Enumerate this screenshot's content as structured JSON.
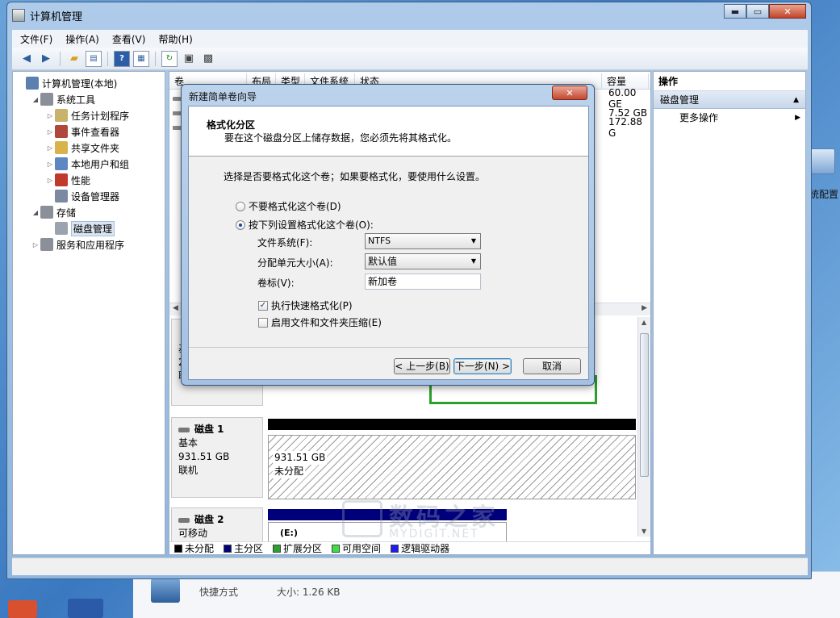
{
  "window": {
    "title": "计算机管理",
    "caption": {
      "minimize": "▬",
      "maximize": "▭",
      "close": "✕"
    }
  },
  "menu": [
    "文件(F)",
    "操作(A)",
    "查看(V)",
    "帮助(H)"
  ],
  "toolbar": {
    "icons": [
      "back-arrow-icon",
      "forward-arrow-icon",
      "up-folder-icon",
      "show-tree-icon",
      "help-icon",
      "properties-icon",
      "refresh-icon",
      "export-icon",
      "settings-icon"
    ],
    "help_glyph": "?"
  },
  "tree": {
    "items": [
      {
        "label": "计算机管理(本地)",
        "expander": "",
        "icon_color": "#5b7fae",
        "indent": 0
      },
      {
        "label": "系统工具",
        "expander": "◢",
        "icon_color": "#8a8f99",
        "indent": 1
      },
      {
        "label": "任务计划程序",
        "expander": "▷",
        "icon_color": "#c9b26b",
        "indent": 2
      },
      {
        "label": "事件查看器",
        "expander": "▷",
        "icon_color": "#b0473c",
        "indent": 2
      },
      {
        "label": "共享文件夹",
        "expander": "▷",
        "icon_color": "#d8b24a",
        "indent": 2
      },
      {
        "label": "本地用户和组",
        "expander": "▷",
        "icon_color": "#5d86c2",
        "indent": 2
      },
      {
        "label": "性能",
        "expander": "▷",
        "icon_color": "#c0392b",
        "indent": 2
      },
      {
        "label": "设备管理器",
        "expander": "",
        "icon_color": "#7b8aa0",
        "indent": 2
      },
      {
        "label": "存储",
        "expander": "◢",
        "icon_color": "#8a8f99",
        "indent": 1
      },
      {
        "label": "磁盘管理",
        "expander": "",
        "icon_color": "#9aa3af",
        "indent": 2,
        "selected": true
      },
      {
        "label": "服务和应用程序",
        "expander": "▷",
        "icon_color": "#8a8f99",
        "indent": 1
      }
    ]
  },
  "volumes": {
    "headers": [
      "卷",
      "布局",
      "类型",
      "文件系统",
      "状态",
      "容量"
    ],
    "capacities": [
      "60.00 GE",
      "7.52 GB",
      "172.88 G"
    ]
  },
  "disks": [
    {
      "name": "磁盘 1",
      "type": "基本",
      "size": "931.51 GB",
      "state": "联机",
      "partition_size": "931.51 GB",
      "partition_state": "未分配"
    },
    {
      "name": "磁盘 2",
      "type": "可移动",
      "partition_label": "(E:)"
    }
  ],
  "disk0_partial": {
    "type_char": "基",
    "line2": "2",
    "line3": "联"
  },
  "legend": [
    {
      "label": "未分配",
      "color": "#000000"
    },
    {
      "label": "主分区",
      "color": "#00007b"
    },
    {
      "label": "扩展分区",
      "color": "#2aa12a"
    },
    {
      "label": "可用空间",
      "color": "#3ee03e"
    },
    {
      "label": "逻辑驱动器",
      "color": "#1d1df0"
    }
  ],
  "actions": {
    "header": "操作",
    "section": "磁盘管理",
    "section_caret": "▲",
    "more": "更多操作",
    "more_arrow": "▶"
  },
  "wizard": {
    "title": "新建简单卷向导",
    "close": "✕",
    "heading": "格式化分区",
    "subheading": "要在这个磁盘分区上储存数据，您必须先将其格式化。",
    "question": "选择是否要格式化这个卷；如果要格式化，要使用什么设置。",
    "option_no_format": "不要格式化这个卷(D)",
    "option_format": "按下列设置格式化这个卷(O):",
    "fs_label": "文件系统(F):",
    "fs_value": "NTFS",
    "alloc_label": "分配单元大小(A):",
    "alloc_value": "默认值",
    "vol_label_label": "卷标(V):",
    "vol_label_value": "新加卷",
    "quick_format": "执行快速格式化(P)",
    "quick_format_checked": true,
    "compression": "启用文件和文件夹压缩(E)",
    "back": "< 上一步(B)",
    "next": "下一步(N) >",
    "cancel": "取消"
  },
  "watermark": {
    "cn": "数码之家",
    "en": "MYDIGIT.NET"
  },
  "desktop": {
    "right_label": "统配置",
    "bottom_row": {
      "type": "快捷方式",
      "size": "大小: 1.26 KB"
    }
  }
}
